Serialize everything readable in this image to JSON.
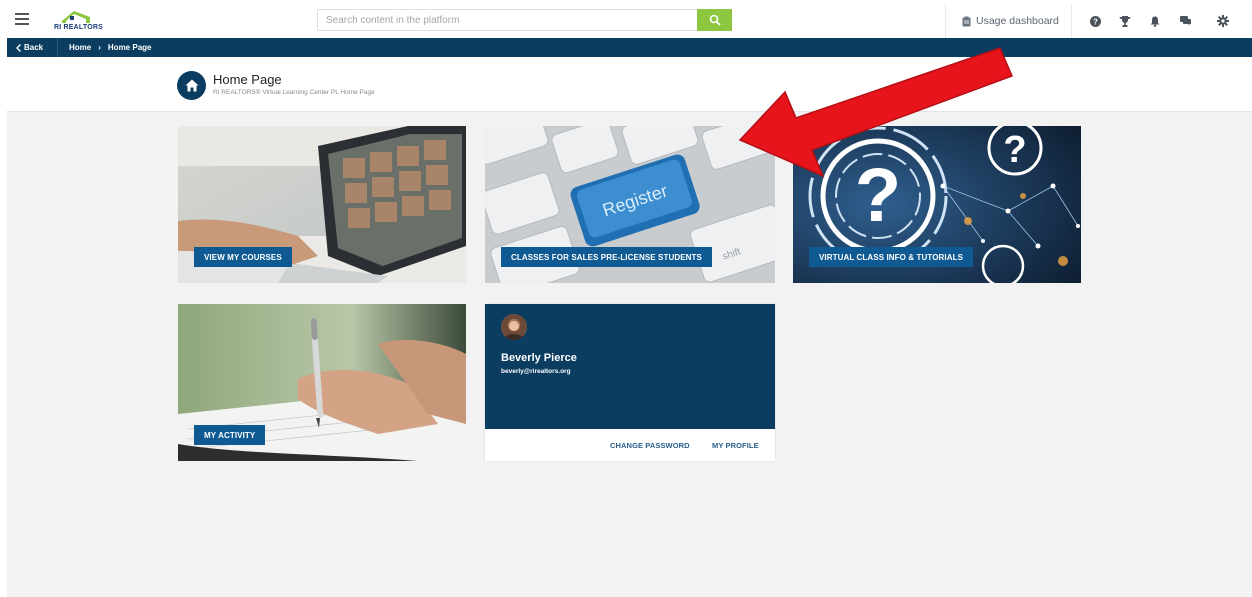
{
  "header": {
    "logo_text": "RI REALTORS",
    "search_placeholder": "Search content in the platform",
    "usage_label": "Usage dashboard",
    "icons": [
      "menu-icon",
      "search-icon",
      "clipboard-icon",
      "help-icon",
      "trophy-icon",
      "bell-icon",
      "chat-icon",
      "gear-icon"
    ]
  },
  "breadcrumb": {
    "back_label": "Back",
    "items": [
      "Home",
      "Home Page"
    ],
    "separator": "›"
  },
  "page": {
    "title": "Home Page",
    "subtitle": "RI REALTORS® Virtual Learning Center PL Home Page"
  },
  "tiles": [
    {
      "label": "VIEW MY COURSES",
      "image": "laptop-video-call"
    },
    {
      "label": "CLASSES FOR SALES PRE-LICENSE STUDENTS",
      "image": "register-keyboard"
    },
    {
      "label": "VIRTUAL CLASS INFO & TUTORIALS",
      "image": "question-mark-network"
    },
    {
      "label": "MY ACTIVITY",
      "image": "hand-writing-pen"
    }
  ],
  "register_key_text": "Register",
  "shift_key_text": "shift",
  "profile": {
    "name": "Beverly Pierce",
    "email": "beverly@rirealtors.org",
    "change_password": "CHANGE PASSWORD",
    "my_profile": "MY PROFILE"
  },
  "colors": {
    "navbar": "#0b3d61",
    "tile_label": "#0f5a92",
    "search_button": "#8dc63f",
    "annotation_arrow": "#e8141c",
    "content_bg": "#f2f2f2"
  }
}
